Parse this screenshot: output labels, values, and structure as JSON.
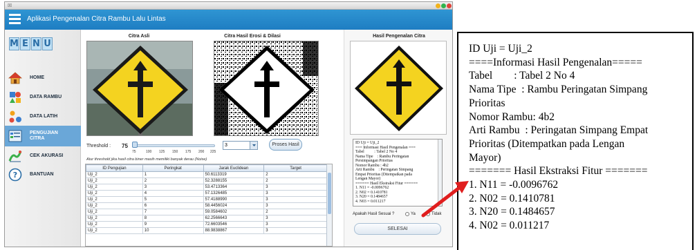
{
  "window": {
    "chrome_text": "☒",
    "title": "Aplikasi Pengenalan Citra Rambu Lalu Lintas",
    "controls": [
      {
        "name": "minimize",
        "color": "#f2b21b"
      },
      {
        "name": "maximize",
        "color": "#2fb44d"
      },
      {
        "name": "close",
        "color": "#e0443a"
      }
    ]
  },
  "sidebar": {
    "logo_letters": [
      "M",
      "E",
      "N",
      "U"
    ],
    "items": [
      {
        "label": "HOME",
        "icon": "home-icon",
        "active": false
      },
      {
        "label": "DATA RAMBU",
        "icon": "shapes-icon",
        "active": false
      },
      {
        "label": "DATA LATIH",
        "icon": "dots-icon",
        "active": false
      },
      {
        "label": "PENGUJIAN",
        "label2": "CITRA",
        "icon": "test-image-icon",
        "active": true
      },
      {
        "label": "CEK AKURASI",
        "icon": "accuracy-chart-icon",
        "active": false
      },
      {
        "label": "BANTUAN",
        "icon": "help-icon",
        "active": false
      }
    ]
  },
  "main": {
    "titles": {
      "asli": "Citra Asli",
      "erosi": "Citra Hasil Erosi & Dilasi",
      "hasil": "Hasil Pengenalan Citra"
    },
    "threshold": {
      "label": "Threshold :",
      "value": "75",
      "ticks": [
        "75",
        "100",
        "125",
        "150",
        "175",
        "200",
        "225"
      ],
      "note": "Atur threshold jika hasil citra biner masih memiliki banyak derau (Noise)"
    },
    "stepper_value": "3",
    "proses_button": "Proses Hasil",
    "table": {
      "headers": [
        "ID Pengujian",
        "Peringkat",
        "Jarak Euclidean",
        "Target"
      ],
      "rows": [
        [
          "Uji_2",
          "1",
          "50.6113319",
          "2"
        ],
        [
          "Uji_2",
          "2",
          "52.3288155",
          "2"
        ],
        [
          "Uji_2",
          "3",
          "53.4713364",
          "3"
        ],
        [
          "Uji_2",
          "4",
          "57.1326485",
          "3"
        ],
        [
          "Uji_2",
          "5",
          "57.4188990",
          "3"
        ],
        [
          "Uji_2",
          "6",
          "58.4456024",
          "3"
        ],
        [
          "Uji_2",
          "7",
          "59.0584602",
          "2"
        ],
        [
          "Uji_2",
          "8",
          "62.2566643",
          "3"
        ],
        [
          "Uji_2",
          "9",
          "72.6603546",
          "3"
        ],
        [
          "Uji_2",
          "10",
          "88.9838867",
          "3"
        ]
      ]
    }
  },
  "right_panel": {
    "result_lines": [
      "ID Uji = Uji_2",
      "=== Informasi Hasil Pengenalan ===",
      "Tabel          : Tabel 2 No 4",
      "Nama Tipe    : Rambu Peringatan",
      "Persimpangan Prioritas",
      "Nomor Rambu : 4b2",
      "Arti Rambu    : Peringatan Simpang",
      "Empat Prioritas (Ditempatkan pada",
      "Lengan Mayor)",
      "====== Hasil Ekstraksi Fitur ======",
      "1. N11 = -0.0096762",
      "2. N02 = 0.1410781",
      "3. N20 = 0.1484657",
      "4. N03 = 0.011217"
    ],
    "question": "Apakah Hasil Sesuai ?",
    "options": [
      "Ya",
      "Tidak"
    ],
    "selesai_button": "SELESAI"
  },
  "zoom": {
    "lines": [
      "ID Uji = Uji_2",
      "====Informasi Hasil Pengenalan=====",
      "Tabel        : Tabel 2 No 4",
      "Nama Tipe  : Rambu Peringatan Simpang",
      "Prioritas",
      "Nomor Rambu: 4b2",
      "Arti Rambu  : Peringatan Simpang Empat",
      "Prioritas (Ditempatkan pada Lengan",
      "Mayor)",
      "======= Hasil Ekstraksi Fitur =======",
      "1. N11 = -0.0096762",
      "2. N02 = 0.1410781",
      "3. N20 = 0.1484657",
      "4. N02 = 0.011217"
    ]
  },
  "colors": {
    "titlebar": "#1e7dc2",
    "active_nav": "#6aa7d8",
    "sign_yellow": "#f4d320",
    "arrow_red": "#e01e1e"
  }
}
